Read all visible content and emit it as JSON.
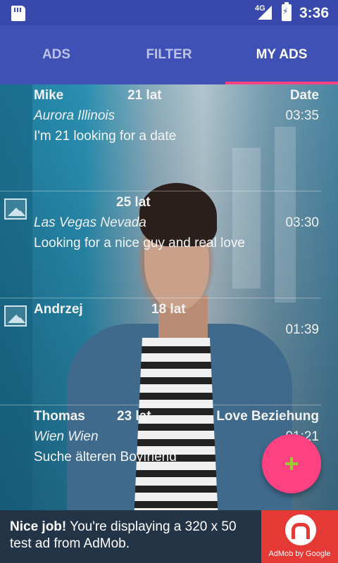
{
  "status_bar": {
    "network": "4G",
    "time": "3:36"
  },
  "tabs": [
    {
      "label": "ADS",
      "active": false
    },
    {
      "label": "FILTER",
      "active": false
    },
    {
      "label": "MY ADS",
      "active": true
    }
  ],
  "colors": {
    "primary": "#3F51B5",
    "primary_dark": "#3949AB",
    "accent": "#FF4081",
    "fab_icon": "#9ACD32",
    "ad_brand": "#E53935"
  },
  "ads": [
    {
      "name": "Mike",
      "age": "21 lat",
      "category": "Date",
      "location": "Aurora Illinois",
      "time": "03:35",
      "message": "I'm 21 looking for a date",
      "has_image": false
    },
    {
      "name": "",
      "age": "25 lat",
      "category": "",
      "location": "Las Vegas Nevada",
      "time": "03:30",
      "message": "Looking for a nice guy and real love",
      "has_image": true
    },
    {
      "name": "Andrzej",
      "age": "18 lat",
      "category": "",
      "location": "",
      "time": "01:39",
      "message": "",
      "has_image": true
    },
    {
      "name": "Thomas",
      "age": "23 lat",
      "category": "Love Beziehung",
      "location": "Wien Wien",
      "time": "01:21",
      "message": "Suche älteren Boyfriend",
      "has_image": false
    }
  ],
  "fab": {
    "label": "+",
    "icon": "add-icon"
  },
  "ad_banner": {
    "bold": "Nice job!",
    "text": " You're displaying a 320 x 50 test ad from AdMob.",
    "brand": "AdMob by Google"
  }
}
